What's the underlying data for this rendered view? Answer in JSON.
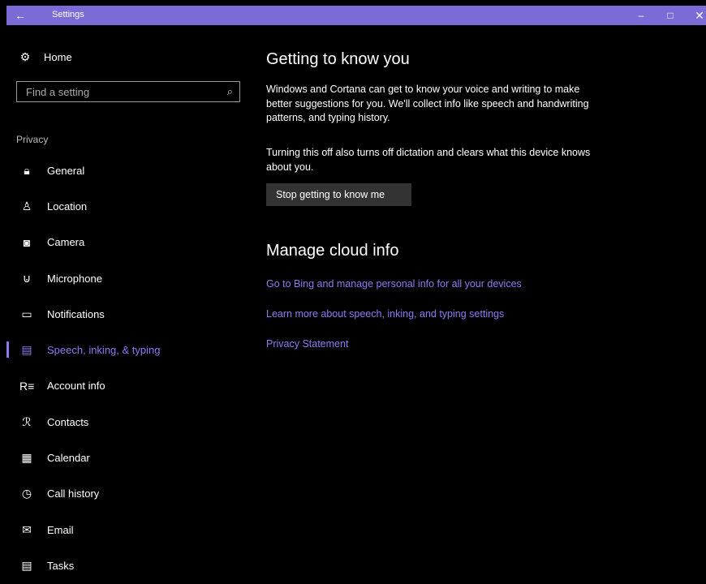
{
  "titlebar": {
    "back_icon": "back-arrow-icon",
    "title": "Settings",
    "minimize": "–",
    "maximize": "□",
    "close": "✕"
  },
  "sidebar": {
    "home": {
      "icon": "gear-icon",
      "label": "Home"
    },
    "search": {
      "placeholder": "Find a setting",
      "icon": "search-icon"
    },
    "section": "Privacy",
    "items": [
      {
        "label": "General",
        "icon": "lock-icon",
        "active": false
      },
      {
        "label": "Location",
        "icon": "location-icon",
        "active": false
      },
      {
        "label": "Camera",
        "icon": "camera-icon",
        "active": false
      },
      {
        "label": "Microphone",
        "icon": "microphone-icon",
        "active": false
      },
      {
        "label": "Notifications",
        "icon": "notifications-icon",
        "active": false
      },
      {
        "label": "Speech, inking, & typing",
        "icon": "speech-icon",
        "active": true
      },
      {
        "label": "Account info",
        "icon": "account-info-icon",
        "active": false
      },
      {
        "label": "Contacts",
        "icon": "contacts-icon",
        "active": false
      },
      {
        "label": "Calendar",
        "icon": "calendar-icon",
        "active": false
      },
      {
        "label": "Call history",
        "icon": "call-history-icon",
        "active": false
      },
      {
        "label": "Email",
        "icon": "email-icon",
        "active": false
      },
      {
        "label": "Tasks",
        "icon": "tasks-icon",
        "active": false
      }
    ]
  },
  "main": {
    "heading1": "Getting to know you",
    "para1": "Windows and Cortana can get to know your voice and writing to make better suggestions for you. We'll collect info like speech and handwriting patterns, and typing history.",
    "para2": "Turning this off also turns off dictation and clears what this device knows about you.",
    "button": "Stop getting to know me",
    "heading2": "Manage cloud info",
    "links": [
      "Go to Bing and manage personal info for all your devices",
      "Learn more about speech, inking, and typing settings",
      "Privacy Statement"
    ]
  },
  "colors": {
    "accent": "#7a6bd6",
    "link": "#8a7cf0",
    "background": "#000000"
  }
}
